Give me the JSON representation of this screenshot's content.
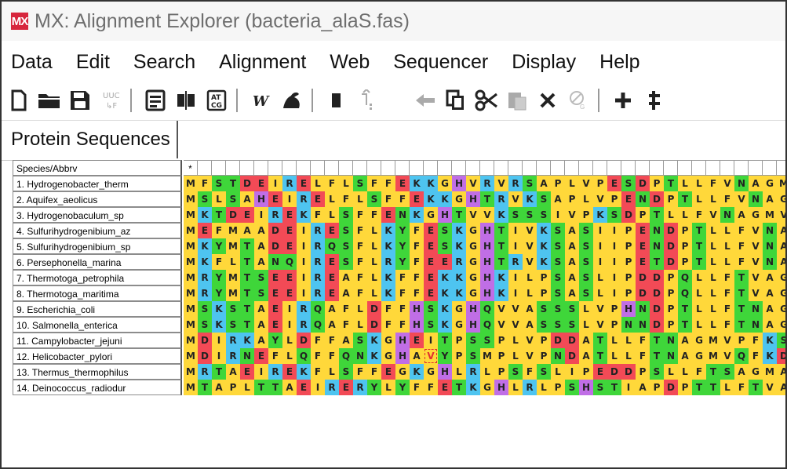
{
  "window": {
    "app_icon": "MX",
    "title": "MX: Alignment Explorer (bacteria_alaS.fas)"
  },
  "menu": [
    "Data",
    "Edit",
    "Search",
    "Alignment",
    "Web",
    "Sequencer",
    "Display",
    "Help"
  ],
  "toolbar": {
    "buttons": [
      {
        "name": "new-file-icon"
      },
      {
        "name": "open-folder-icon"
      },
      {
        "name": "save-icon"
      },
      {
        "name": "uuc-translate-icon",
        "label": "UUC"
      },
      {
        "name": "text-view-icon"
      },
      {
        "name": "columns-icon"
      },
      {
        "name": "atcg-icon",
        "label": "AT CG"
      },
      {
        "name": "w-align-icon",
        "label": "W"
      },
      {
        "name": "muscle-icon"
      },
      {
        "name": "mark-site-icon"
      },
      {
        "name": "goto-icon"
      },
      {
        "name": "undo-icon"
      },
      {
        "name": "copy-icon"
      },
      {
        "name": "cut-icon"
      },
      {
        "name": "paste-icon"
      },
      {
        "name": "delete-icon"
      },
      {
        "name": "delete-gap-icon"
      },
      {
        "name": "add-icon"
      },
      {
        "name": "expand-icon"
      }
    ]
  },
  "tab": {
    "label": "Protein Sequences"
  },
  "grid": {
    "header_name": "Species/Abbrv",
    "header_mark": "*",
    "sequences": [
      {
        "name": "1. Hydrogenobacter_therm",
        "seq": "MFSTDEIRELFLSFFEKKGHVRVRSAPLVPESDPTLLFVNAGMV"
      },
      {
        "name": "2. Aquifex_aeolicus",
        "seq": "MSLSAHEIRELFLSFFEKKGHTRVKSAPLVPENDPTLLFVNAGM"
      },
      {
        "name": "3. Hydrogenobaculum_sp",
        "seq": "MKTDEIREKFLSFFENKGHTVVKSSSIVPKSDPTLLFVNAGMVP"
      },
      {
        "name": "4. Sulfurihydrogenibium_az",
        "seq": "MEFMAADEIRESFLKYFESKGHTIVKSASIIPENDPTLLFVNAG"
      },
      {
        "name": "5. Sulfurihydrogenibium_sp",
        "seq": "MKYMTADEIRQSFLKYFESKGHTIVKSASIIPENDPTLLFVNAG"
      },
      {
        "name": "6. Persephonella_marina",
        "seq": "MKFLTANQIRESFLRYFEERGHTRVKSASIIPETDPTLLFVNAG"
      },
      {
        "name": "7. Thermotoga_petrophila",
        "seq": "MRYMTSEEIREAFLKFFEKKGHKILPSASLIPDDPQLLFTVAGM"
      },
      {
        "name": "8. Thermotoga_maritima",
        "seq": "MRYMTSEEIREAFLKFFEKKGHKILPSASLIPDDPQLLFTVAGM"
      },
      {
        "name": "9. Escherichia_coli",
        "seq": "MSKSTAEIRQAFLDFFHSKGHQVVASSSLVPHNDPTLLFTNAGM"
      },
      {
        "name": "10. Salmonella_enterica",
        "seq": "MSKSTAEIRQAFLDFFHSKGHQVVASSSLVPNNDPTLLFTNAGM"
      },
      {
        "name": "11. Campylobacter_jejuni",
        "seq": "MDIRKAYLDFFASKGHEITPSSPLVPDDATLLFTNAGMVPFKSI"
      },
      {
        "name": "12. Helicobacter_pylori",
        "seq": "MDIRNEFLQFFQNKGHAVYPSMPLVPNDATLLFTNAGMVQFKDI"
      },
      {
        "name": "13. Thermus_thermophilus",
        "seq": "MRTAEIREKFLSFFEGKGHLRLPSFSLIPEDDPSLLFTSAGMAP"
      },
      {
        "name": "14. Deinococcus_radiodur",
        "seq": "MTAPLTTAEIRERYLYFFETKGHLRLPSHSTIAPDPTTLFTVAG"
      }
    ],
    "cursor": {
      "row": 11,
      "col": 17
    }
  },
  "colors": {
    "G": "#ffd83a",
    "A": "#ffd83a",
    "V": "#ffd83a",
    "L": "#ffd83a",
    "I": "#ffd83a",
    "P": "#ffd83a",
    "F": "#ffd83a",
    "M": "#ffd83a",
    "W": "#ffd83a",
    "C": "#ffd83a",
    "S": "#3fd63a",
    "T": "#3fd63a",
    "Y": "#3fd63a",
    "N": "#3fd63a",
    "Q": "#3fd63a",
    "D": "#f24a56",
    "E": "#f24a56",
    "K": "#4ec4f0",
    "R": "#4ec4f0",
    "H": "#c06ee6"
  }
}
